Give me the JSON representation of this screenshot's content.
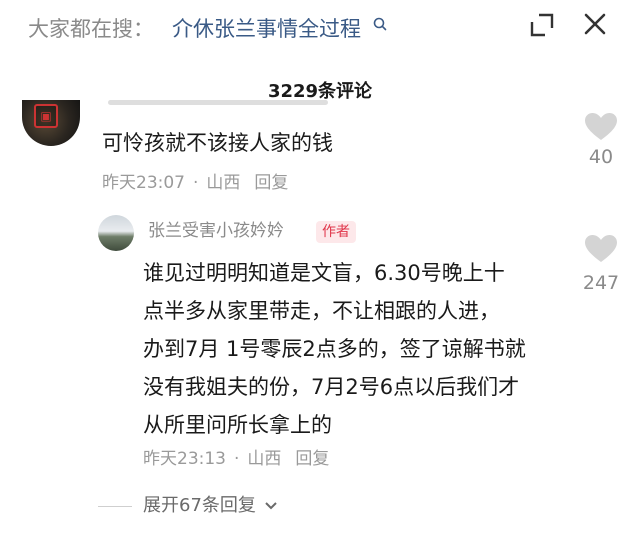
{
  "search": {
    "prefix": "大家都在搜：",
    "term": "介休张兰事情全过程"
  },
  "header": {
    "comment_count": "3229条评论"
  },
  "comments": [
    {
      "text": "可怜孩就不该接人家的钱",
      "time": "昨天23:07",
      "location": "山西",
      "reply_label": "回复",
      "likes": "40"
    }
  ],
  "reply": {
    "author": "张兰受害小孩妗妗",
    "badge": "作者",
    "lines": [
      "谁见过明明知道是文盲，6.30号晚上十",
      "点半多从家里带走，不让相跟的人进，",
      "办到7月 1号零辰2点多的，签了谅解书就",
      "没有我姐夫的份，7月2号6点以后我们才",
      "从所里问所长拿上的"
    ],
    "time": "昨天23:13",
    "location": "山西",
    "reply_label": "回复",
    "likes": "247"
  },
  "expand": {
    "label": "展开67条回复"
  },
  "icons": {
    "search": "search-icon",
    "collapse": "collapse-icon",
    "close": "close-icon",
    "like": "heart-icon",
    "chevron": "chevron-down-icon"
  },
  "colors": {
    "author_badge": "#e0364b",
    "search_term": "#3a5a86"
  }
}
